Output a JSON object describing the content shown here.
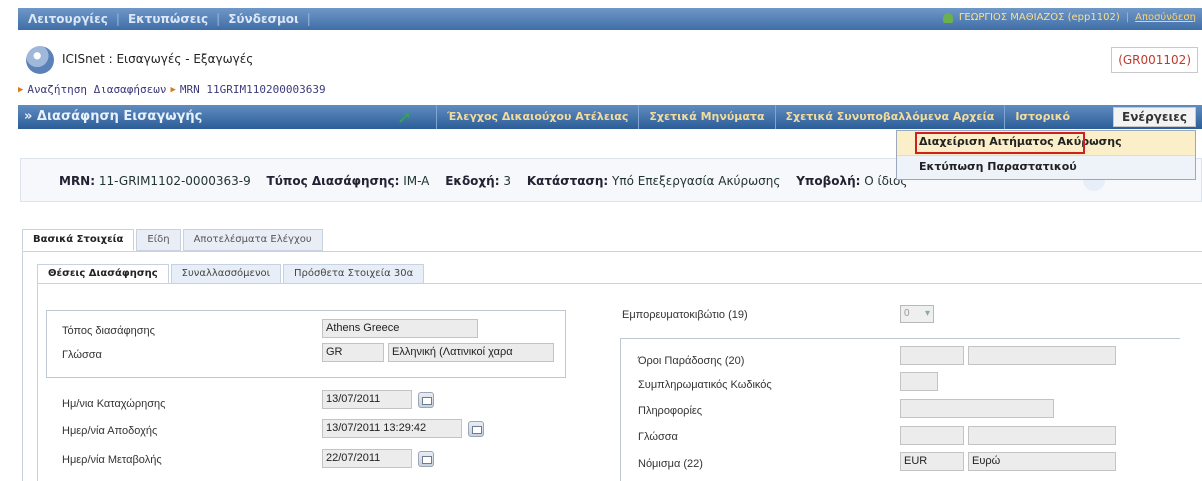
{
  "topbar": {
    "menu": [
      "Λειτουργίες",
      "Εκτυπώσεις",
      "Σύνδεσμοι"
    ],
    "user": "ΓΕΩΡΓΙΟΣ ΜΑΘΙΑΖΟΣ (epp1102)",
    "logout": "Αποσύνδεση"
  },
  "app": {
    "title": "ICISnet : Εισαγωγές - Εξαγωγές",
    "code": "(GR001102)"
  },
  "breadcrumb": {
    "item1": "Αναζήτηση Διασαφήσεων",
    "item2": "MRN 11GRIM110200003639"
  },
  "titlebar": {
    "title": "» Διασάφηση Εισαγωγής",
    "tabs": [
      "Έλεγχος Δικαιούχου Ατέλειας",
      "Σχετικά Μηνύματα",
      "Σχετικά Συνυποβαλλόμενα Αρχεία",
      "Ιστορικό"
    ],
    "actions": "Ενέργειες"
  },
  "dropdown": {
    "item1": "Διαχείριση Αιτήματος Ακύρωσης",
    "item2": "Εκτύπωση Παραστατικού"
  },
  "info": {
    "mrn_label": "MRN:",
    "mrn": "11-GRIM1102-0000363-9",
    "type_label": "Τύπος Διασάφησης:",
    "type": "IM-A",
    "version_label": "Εκδοχή:",
    "version": "3",
    "status_label": "Κατάσταση:",
    "status": "Υπό Επεξεργασία Ακύρωσης",
    "submission_label": "Υποβολή:",
    "submission": "Ο ίδιος"
  },
  "main_tabs": [
    "Βασικά Στοιχεία",
    "Είδη",
    "Αποτελέσματα Ελέγχου"
  ],
  "sub_tabs": [
    "Θέσεις Διασάφησης",
    "Συναλλασσόμενοι",
    "Πρόσθετα Στοιχεία 30α"
  ],
  "left": {
    "place_label": "Τόπος διασάφησης",
    "place_value": "Athens Greece",
    "lang_label": "Γλώσσα",
    "lang_code": "GR",
    "lang_name": "Ελληνική (Λατινικοί χαρα",
    "reg_date_label": "Ημ/νια Καταχώρησης",
    "reg_date": "13/07/2011",
    "acc_date_label": "Ημερ/νία Αποδοχής",
    "acc_date": "13/07/2011 13:29:42",
    "mod_date_label": "Ημερ/νία Μεταβολής",
    "mod_date": "22/07/2011"
  },
  "right": {
    "container_label": "Εμπορευματοκιβώτιο (19)",
    "container_value": "0",
    "terms_label": "Όροι Παράδοσης (20)",
    "code_label": "Συμπληρωματικός Κωδικός",
    "info_label": "Πληροφορίες",
    "lang_label": "Γλώσσα",
    "currency_label": "Νόμισμα (22)",
    "currency_code": "EUR",
    "currency_name": "Ευρώ"
  }
}
